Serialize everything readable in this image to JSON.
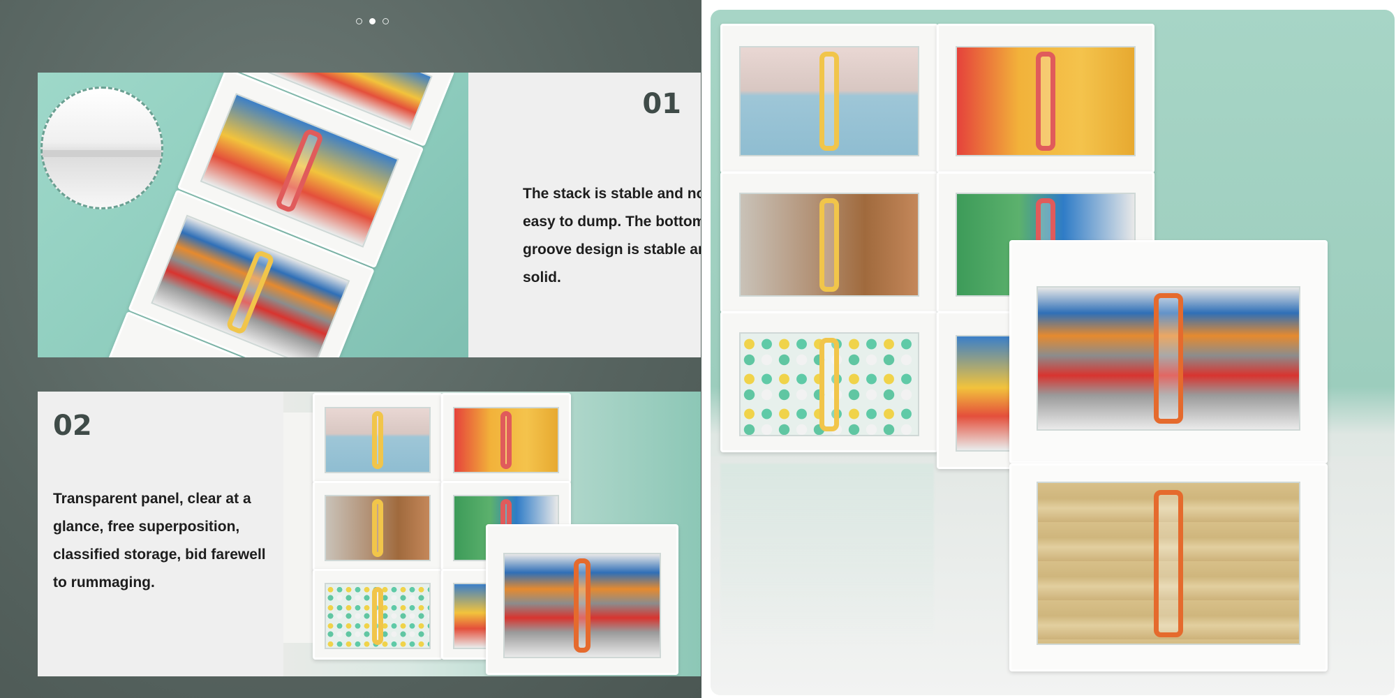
{
  "carousel": {
    "dot_count": 3,
    "active_index": 1
  },
  "features": [
    {
      "number": "01",
      "text": "The stack is stable and not easy to dump. The bottom groove design is stable and solid."
    },
    {
      "number": "02",
      "text": "Transparent panel, clear at a glance, free superposition, classified storage, bid farewell to rummaging."
    }
  ],
  "colors": {
    "panel_bg": "#56635f",
    "mint": "#9ed8c9",
    "text_box": "#efefef",
    "number_text": "#3f4b48",
    "handle_yellow": "#f1c54a",
    "handle_red": "#e05b5b",
    "handle_orange": "#e56a2d"
  }
}
